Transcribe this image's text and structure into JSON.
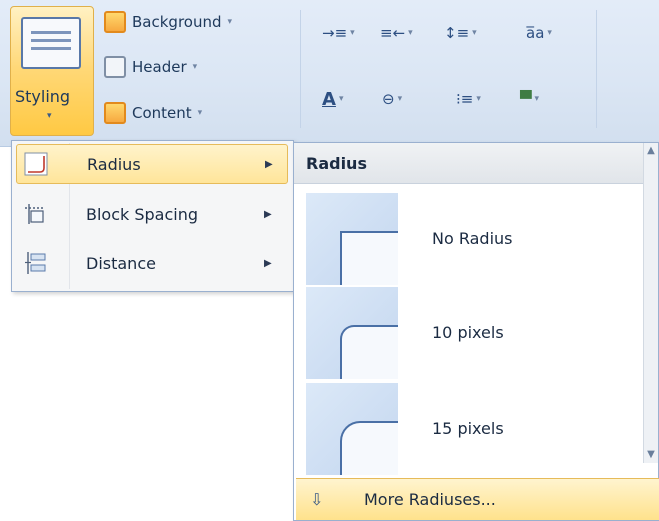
{
  "ribbon": {
    "styling_label": "Styling",
    "background_label": "Background",
    "header_label": "Header",
    "content_label": "Content",
    "caret": "▾",
    "tools_row1": [
      "→≡",
      "≡←",
      "↕≡",
      "a̅a"
    ],
    "tools_row2": [
      "A",
      "⊖",
      "⁝≡",
      "▀"
    ]
  },
  "styling_menu": {
    "items": [
      {
        "label": "Radius",
        "icon": "radius-corner-icon",
        "arrow": "▶",
        "highlighted": true
      },
      {
        "label": "Block Spacing",
        "icon": "block-spacing-icon",
        "arrow": "▶",
        "highlighted": false
      },
      {
        "label": "Distance",
        "icon": "distance-icon",
        "arrow": "▶",
        "highlighted": false
      }
    ]
  },
  "radius_gallery": {
    "title": "Radius",
    "items": [
      {
        "label": "No Radius",
        "radius_px": 0
      },
      {
        "label": "10 pixels",
        "radius_px": 10
      },
      {
        "label": "15 pixels",
        "radius_px": 15
      }
    ],
    "more_label": "More Radiuses...",
    "scroll_up": "▲",
    "scroll_down": "▼"
  },
  "colors": {
    "ribbon_bg": "#dbe6f4",
    "highlight_gold": "#ffd877",
    "text_dark_blue": "#1e395b",
    "accent_blue": "#4a70a6"
  }
}
